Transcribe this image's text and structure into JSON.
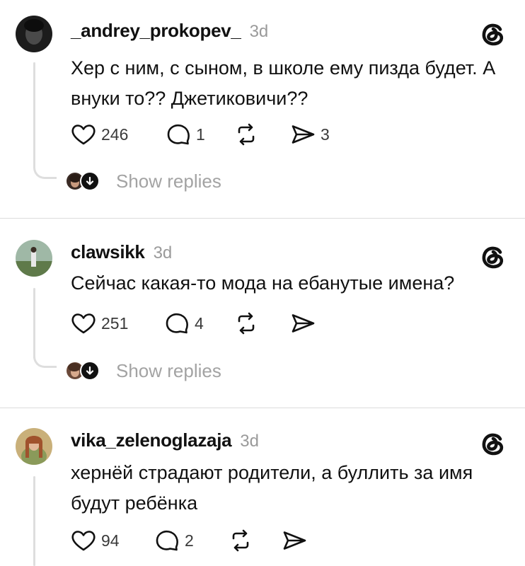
{
  "comments": [
    {
      "username": "_andrey_prokopev_",
      "time": "3d",
      "text": "Хер с ним, с сыном, в школе ему пизда будет. А внуки то?? Джетиковичи??",
      "likes": "246",
      "replies": "1",
      "shares": "3",
      "show_replies": "Show replies"
    },
    {
      "username": "clawsikk",
      "time": "3d",
      "text": "Сейчас какая-то мода на ебанутые имена?",
      "likes": "251",
      "replies": "4",
      "shares": "",
      "show_replies": "Show replies"
    },
    {
      "username": "vika_zelenoglazaja",
      "time": "3d",
      "text": "хернёй страдают родители, а буллить за имя будут ребёнка",
      "likes": "94",
      "replies": "2",
      "shares": ""
    }
  ],
  "icons": {
    "like": "heart-icon",
    "reply": "speech-bubble-icon",
    "repost": "repost-icon",
    "share": "send-icon",
    "app": "threads-logo-icon",
    "expand": "arrow-down-icon"
  },
  "colors": {
    "text": "#111111",
    "muted": "#9a9a9a",
    "line": "#dedede"
  }
}
